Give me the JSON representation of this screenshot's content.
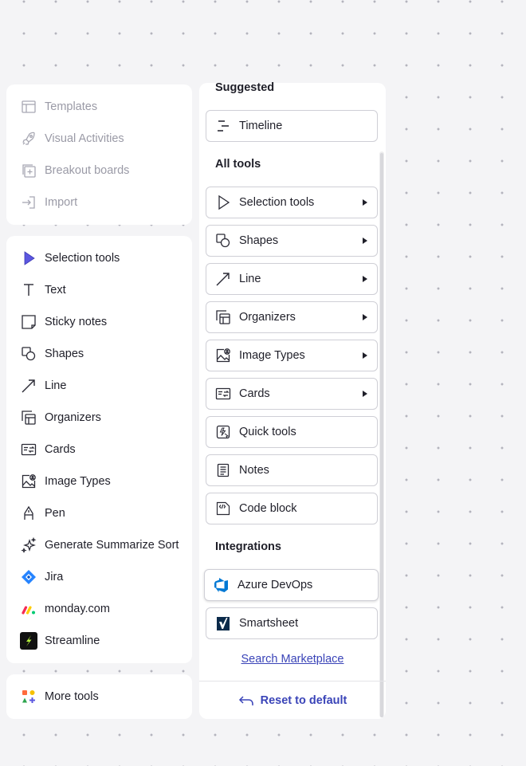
{
  "top_panel": {
    "items": [
      {
        "label": "Templates",
        "icon": "templates-icon"
      },
      {
        "label": "Visual Activities",
        "icon": "rocket-icon"
      },
      {
        "label": "Breakout boards",
        "icon": "breakout-board-icon"
      },
      {
        "label": "Import",
        "icon": "import-icon"
      }
    ]
  },
  "toolbar": {
    "items": [
      {
        "label": "Selection tools",
        "icon": "selection-cursor-icon"
      },
      {
        "label": "Text",
        "icon": "text-icon"
      },
      {
        "label": "Sticky notes",
        "icon": "sticky-note-icon"
      },
      {
        "label": "Shapes",
        "icon": "shapes-icon"
      },
      {
        "label": "Line",
        "icon": "line-arrow-icon"
      },
      {
        "label": "Organizers",
        "icon": "organizers-icon"
      },
      {
        "label": "Cards",
        "icon": "cards-icon"
      },
      {
        "label": "Image Types",
        "icon": "image-types-icon"
      },
      {
        "label": "Pen",
        "icon": "pen-icon"
      },
      {
        "label": "Generate Summarize Sort",
        "icon": "sparkle-icon"
      },
      {
        "label": "Jira",
        "icon": "jira-icon"
      },
      {
        "label": "monday.com",
        "icon": "monday-icon"
      },
      {
        "label": "Streamline",
        "icon": "streamline-icon"
      }
    ]
  },
  "more": {
    "label": "More tools",
    "icon": "more-tools-icon"
  },
  "drawer": {
    "suggested_heading": "Suggested",
    "suggested": [
      {
        "label": "Timeline",
        "icon": "timeline-icon"
      }
    ],
    "all_tools_heading": "All tools",
    "all_tools": [
      {
        "label": "Selection tools",
        "icon": "selection-cursor-icon",
        "submenu": true
      },
      {
        "label": "Shapes",
        "icon": "shapes-icon",
        "submenu": true
      },
      {
        "label": "Line",
        "icon": "line-arrow-icon",
        "submenu": true
      },
      {
        "label": "Organizers",
        "icon": "organizers-icon",
        "submenu": true
      },
      {
        "label": "Image Types",
        "icon": "image-types-icon",
        "submenu": true
      },
      {
        "label": "Cards",
        "icon": "cards-icon",
        "submenu": true
      },
      {
        "label": "Quick tools",
        "icon": "quick-tools-icon",
        "submenu": false
      },
      {
        "label": "Notes",
        "icon": "notes-icon",
        "submenu": false
      },
      {
        "label": "Code block",
        "icon": "code-block-icon",
        "submenu": false
      }
    ],
    "integrations_heading": "Integrations",
    "integrations": [
      {
        "label": "Azure DevOps",
        "icon": "azure-devops-icon"
      },
      {
        "label": "Smartsheet",
        "icon": "smartsheet-icon"
      }
    ],
    "marketplace_link": "Search Marketplace",
    "reset_label": "Reset to default"
  },
  "colors": {
    "accent": "#3a44b8",
    "selection_icon": "#5b57e0",
    "disabled_text": "#9a9aa6"
  }
}
